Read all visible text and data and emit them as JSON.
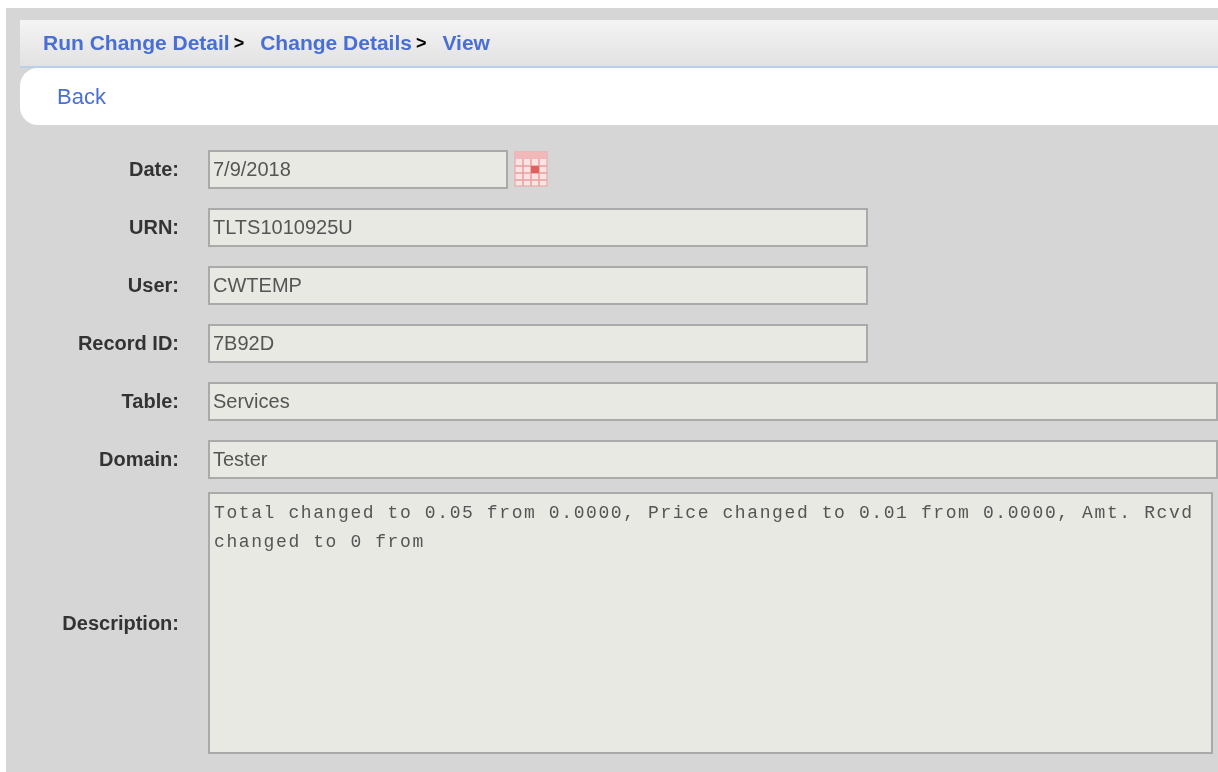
{
  "breadcrumb": [
    {
      "label": "Run Change Detail",
      "separator": ">"
    },
    {
      "label": "Change Details",
      "separator": ">"
    },
    {
      "label": "View"
    }
  ],
  "back_link": "Back",
  "fields": [
    {
      "label": "Date:",
      "value": "7/9/2018",
      "kind": "date"
    },
    {
      "label": "URN:",
      "value": "TLTS1010925U",
      "kind": "short"
    },
    {
      "label": "User:",
      "value": "CWTEMP",
      "kind": "short"
    },
    {
      "label": "Record ID:",
      "value": "7B92D",
      "kind": "short"
    },
    {
      "label": "Table:",
      "value": "Services",
      "kind": "long"
    },
    {
      "label": "Domain:",
      "value": "Tester",
      "kind": "long"
    },
    {
      "label": "Description:",
      "value": "Total changed to 0.05 from 0.0000, Price changed to 0.01 from 0.0000, Amt. Rcvd changed to 0 from",
      "kind": "multiline"
    }
  ]
}
